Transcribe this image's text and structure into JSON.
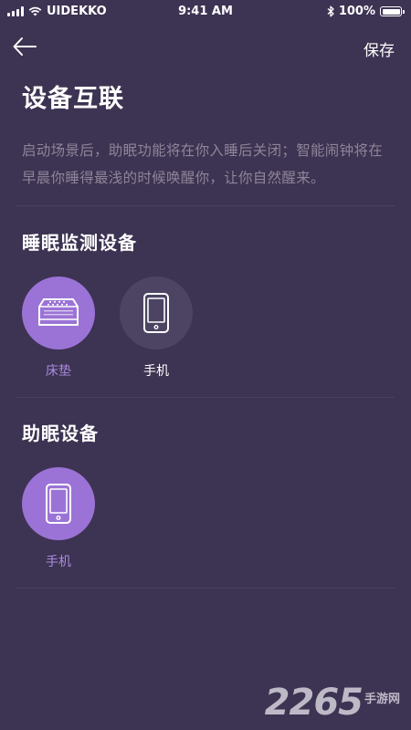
{
  "status_bar": {
    "carrier": "UIDEKKO",
    "time": "9:41 AM",
    "battery": "100%"
  },
  "nav": {
    "save_label": "保存"
  },
  "page_title": "设备互联",
  "description": "启动场景后，助眠功能将在你入睡后关闭；智能闹钟将在早晨你睡得最浅的时候唤醒你，让你自然醒来。",
  "sleep_monitor": {
    "title": "睡眠监测设备",
    "devices": [
      {
        "label": "床垫",
        "icon": "mattress-icon",
        "selected": true
      },
      {
        "label": "手机",
        "icon": "phone-icon",
        "selected": false
      }
    ]
  },
  "sleep_aid": {
    "title": "助眠设备",
    "devices": [
      {
        "label": "手机",
        "icon": "phone-icon",
        "selected": true
      }
    ]
  },
  "watermark": {
    "number": "2265",
    "text": "手游网"
  },
  "colors": {
    "background": "#3d3352",
    "accent": "#9b73d6",
    "inactive_circle": "#4c4462",
    "muted_text": "#8e8599"
  }
}
